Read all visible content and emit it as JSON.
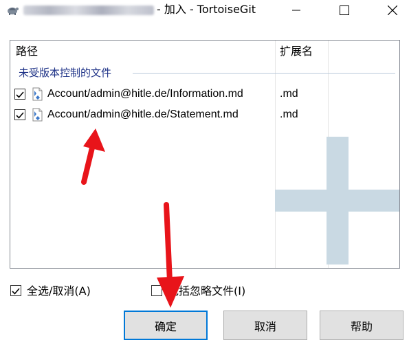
{
  "window": {
    "title": "- 加入 - TortoiseGit",
    "controls": [
      "minimize",
      "maximize",
      "close"
    ]
  },
  "list": {
    "columns": [
      "路径",
      "扩展名"
    ],
    "group_label": "未受版本控制的文件",
    "rows": [
      {
        "checked": true,
        "path": "Account/admin@hitle.de/Information.md",
        "ext": ".md",
        "icon": "unversioned-file-icon"
      },
      {
        "checked": true,
        "path": "Account/admin@hitle.de/Statement.md",
        "ext": ".md",
        "icon": "unversioned-file-icon"
      }
    ]
  },
  "options": {
    "select_all": {
      "label": "全选/取消(A)",
      "checked": true
    },
    "include_ignored": {
      "label": "包括忽略文件(I)",
      "checked": false
    }
  },
  "buttons": {
    "ok": "确定",
    "cancel": "取消",
    "help": "帮助"
  },
  "colors": {
    "group_header": "#1e3287",
    "annotation_arrow": "#e8141a",
    "watermark_plus": "#c9d9e3",
    "default_button_border": "#0078d7"
  }
}
